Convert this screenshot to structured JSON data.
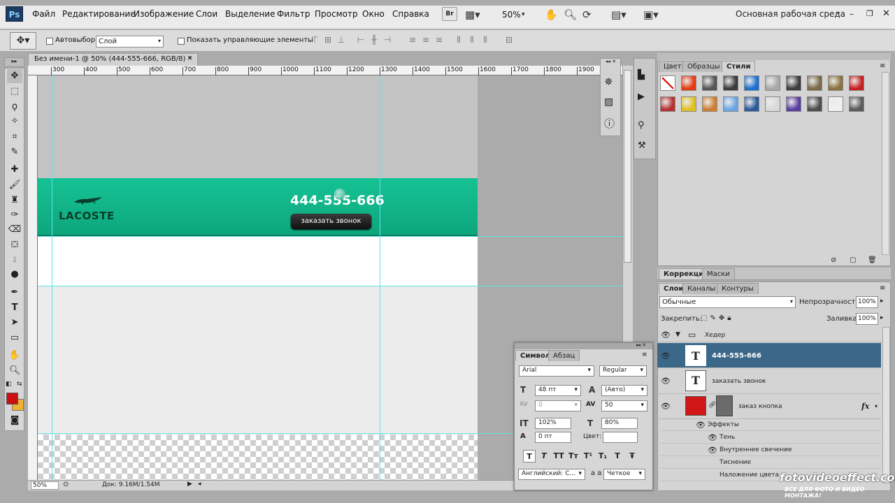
{
  "app": {
    "logo": "Ps",
    "workspace": "Основная рабочая среда",
    "zoom_menu": "50%"
  },
  "menu": [
    "Файл",
    "Редактирование",
    "Изображение",
    "Слои",
    "Выделение",
    "Фильтр",
    "Просмотр",
    "Окно",
    "Справка"
  ],
  "menubar_badge": "Br",
  "options": {
    "autoselect_label": "Автовыбор:",
    "autoselect_value": "Слой",
    "show_controls_label": "Показать управляющие элементы"
  },
  "document": {
    "tab_title": "Без имени-1 @ 50% (444-555-666, RGB/8) *",
    "close": "×",
    "ruler_marks": [
      "300",
      "400",
      "500",
      "600",
      "700",
      "800",
      "900",
      "1000",
      "1100",
      "1200",
      "1300",
      "1400",
      "1500",
      "1600",
      "1700",
      "1800",
      "1900"
    ],
    "status_zoom": "50%",
    "status_doc": "Док: 9.16M/1.54M"
  },
  "site": {
    "logo": "LACOSTE",
    "phone": "444-555-666",
    "button": "заказать звонок"
  },
  "styles_panel": {
    "tabs": [
      "Цвет",
      "Образцы",
      "Стили"
    ],
    "swatches": [
      "#ffffff",
      "#e33a10",
      "#555555",
      "#3a3a3a",
      "#1c6fd1",
      "#a8a8a8",
      "#3d3d3d",
      "#7a6a48",
      "#8a7340",
      "#c52020",
      "#b53030",
      "#e0c020",
      "#d07d30",
      "#6aa6e6",
      "#2a5a9a",
      "#d8d8d8",
      "#5a3ca0",
      "#4d4d4d",
      "#f0f0f0",
      "#5a5a5a"
    ]
  },
  "adjust_tabs": [
    "Коррекция",
    "Маски"
  ],
  "layers_panel": {
    "tabs": [
      "Слои",
      "Каналы",
      "Контуры"
    ],
    "blend": "Обычные",
    "opacity_label": "Непрозрачность:",
    "opacity": "100%",
    "lock_label": "Закрепить:",
    "fill_label": "Заливка:",
    "fill": "100%",
    "group": "Хедер",
    "layers": [
      {
        "name": "444-555-666",
        "thumb": "T",
        "selected": true
      },
      {
        "name": "заказать звонок",
        "thumb": "T",
        "selected": false
      },
      {
        "name": "заказ кнопка",
        "thumb": "",
        "selected": false
      }
    ],
    "effects_label": "Эффекты",
    "effects": [
      "Тень",
      "Внутреннее свечение",
      "Тиснение",
      "Наложение цвета"
    ],
    "fx": "fx"
  },
  "char_panel": {
    "tabs": [
      "Символ",
      "Абзац"
    ],
    "font": "Arial",
    "style": "Regular",
    "size": "48 пт",
    "leading": "(Авто)",
    "kerning": "0",
    "tracking": "50",
    "vscale": "102%",
    "hscale": "80%",
    "baseline": "0 пт",
    "color_label": "Цвет:",
    "lang": "Английский: С...",
    "aa_label": "a a",
    "aa": "Четкое",
    "style_buttons": [
      "T",
      "T",
      "TT",
      "Tт",
      "T¹",
      "T₁",
      "T",
      "Ŧ"
    ]
  },
  "watermark": {
    "title": "fotovideoeffect.com",
    "subtitle": "ВСЕ ДЛЯ ФОТО И ВИДЕО МОНТАЖА!"
  }
}
